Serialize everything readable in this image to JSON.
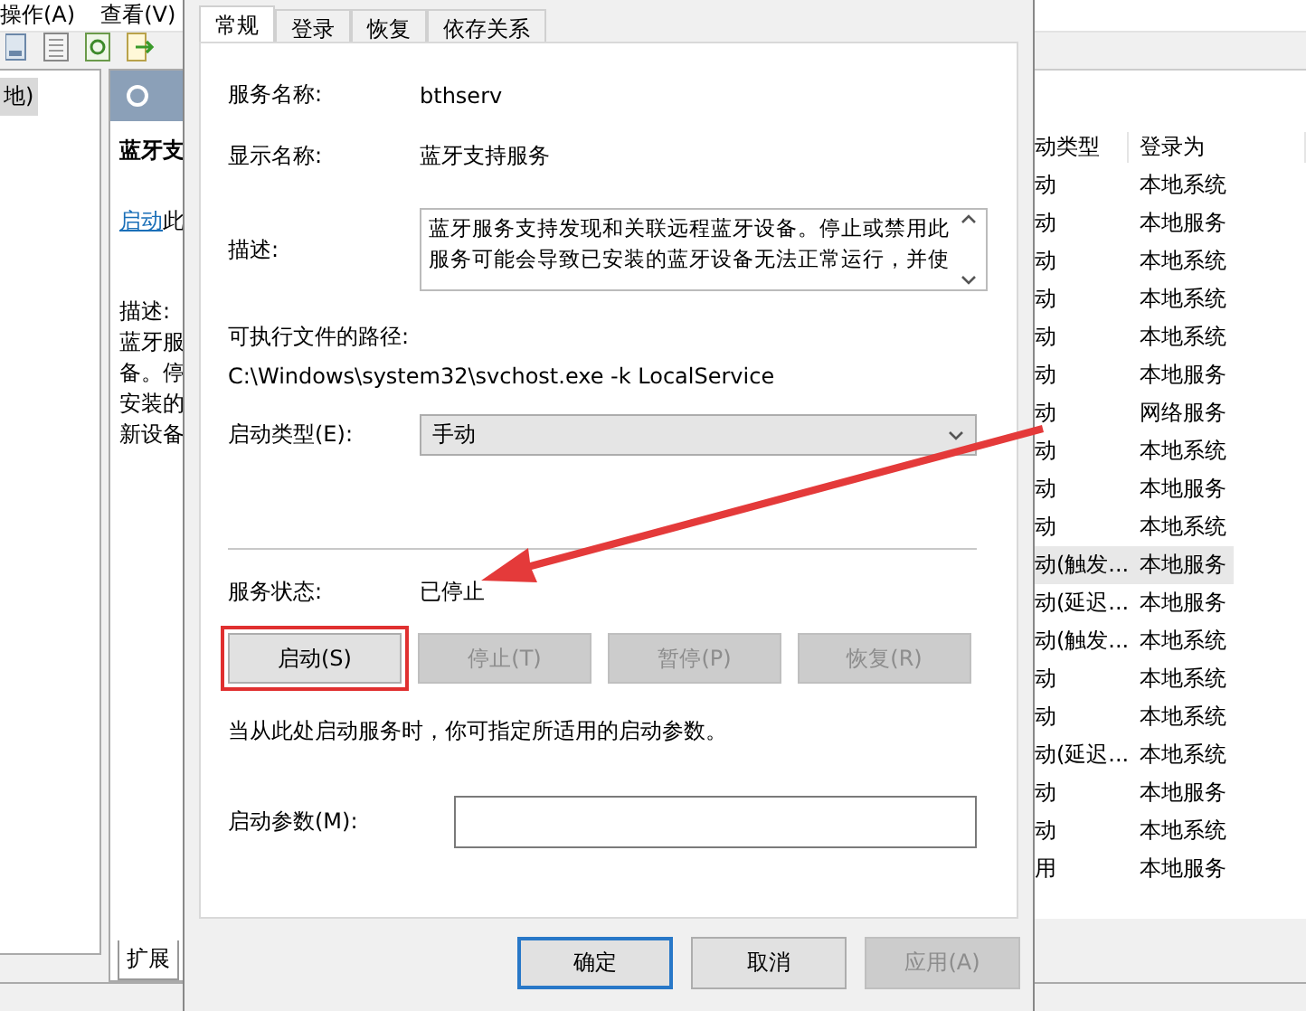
{
  "menu_bar": [
    {
      "label": "操作(A)"
    },
    {
      "label": "查看(V)"
    }
  ],
  "tree": {
    "items": [
      {
        "label": "地)",
        "selected": true
      }
    ]
  },
  "detail_pane": {
    "title": "蓝牙支",
    "link": "启动",
    "link_suffix": "此",
    "description_label": "描述:",
    "description_lines": [
      "蓝牙服",
      "备。停",
      "安装的",
      "新设备"
    ],
    "tabs": [
      {
        "label": "扩展",
        "selected": true
      }
    ]
  },
  "service_list": {
    "columns": [
      "动类型",
      "登录为"
    ],
    "rows": [
      {
        "startup": "动",
        "logon": "本地系统",
        "selected": false
      },
      {
        "startup": "动",
        "logon": "本地服务",
        "selected": false
      },
      {
        "startup": "动",
        "logon": "本地系统",
        "selected": false
      },
      {
        "startup": "动",
        "logon": "本地系统",
        "selected": false
      },
      {
        "startup": "动",
        "logon": "本地系统",
        "selected": false
      },
      {
        "startup": "动",
        "logon": "本地服务",
        "selected": false
      },
      {
        "startup": "动",
        "logon": "网络服务",
        "selected": false
      },
      {
        "startup": "动",
        "logon": "本地系统",
        "selected": false
      },
      {
        "startup": "动",
        "logon": "本地服务",
        "selected": false
      },
      {
        "startup": "动",
        "logon": "本地系统",
        "selected": false
      },
      {
        "startup": "动(触发...",
        "logon": "本地服务",
        "selected": true
      },
      {
        "startup": "动(延迟...",
        "logon": "本地服务",
        "selected": false
      },
      {
        "startup": "动(触发...",
        "logon": "本地系统",
        "selected": false
      },
      {
        "startup": "动",
        "logon": "本地系统",
        "selected": false
      },
      {
        "startup": "动",
        "logon": "本地系统",
        "selected": false
      },
      {
        "startup": "动(延迟...",
        "logon": "本地系统",
        "selected": false
      },
      {
        "startup": "动",
        "logon": "本地服务",
        "selected": false
      },
      {
        "startup": "动",
        "logon": "本地系统",
        "selected": false
      },
      {
        "startup": "用",
        "logon": "本地服务",
        "selected": false
      }
    ]
  },
  "dialog": {
    "tabs": [
      {
        "label": "常规",
        "selected": true
      },
      {
        "label": "登录",
        "selected": false
      },
      {
        "label": "恢复",
        "selected": false
      },
      {
        "label": "依存关系",
        "selected": false
      }
    ],
    "fields": [
      {
        "label": "服务名称:",
        "value": "bthserv"
      },
      {
        "label": "显示名称:",
        "value": "蓝牙支持服务"
      }
    ],
    "description": {
      "label": "描述:",
      "lines": [
        "蓝牙服务支持发现和关联远程蓝牙设备。停止或禁用此",
        "服务可能会导致已安装的蓝牙设备无法正常运行，并使"
      ]
    },
    "path": {
      "label": "可执行文件的路径:",
      "value": "C:\\Windows\\system32\\svchost.exe -k LocalService"
    },
    "startup_type": {
      "label": "启动类型(E):",
      "value": "手动"
    },
    "status": {
      "label": "服务状态:",
      "value": "已停止"
    },
    "service_buttons": [
      {
        "label": "启动(S)",
        "disabled": false,
        "highlighted": true
      },
      {
        "label": "停止(T)",
        "disabled": true,
        "highlighted": false
      },
      {
        "label": "暂停(P)",
        "disabled": true,
        "highlighted": false
      },
      {
        "label": "恢复(R)",
        "disabled": true,
        "highlighted": false
      }
    ],
    "hint": "当从此处启动服务时，你可指定所适用的启动参数。",
    "start_params": {
      "label": "启动参数(M):"
    },
    "buttons": [
      {
        "label": "确定",
        "disabled": false,
        "default": true
      },
      {
        "label": "取消",
        "disabled": false,
        "default": false
      },
      {
        "label": "应用(A)",
        "disabled": true,
        "default": false
      }
    ]
  }
}
